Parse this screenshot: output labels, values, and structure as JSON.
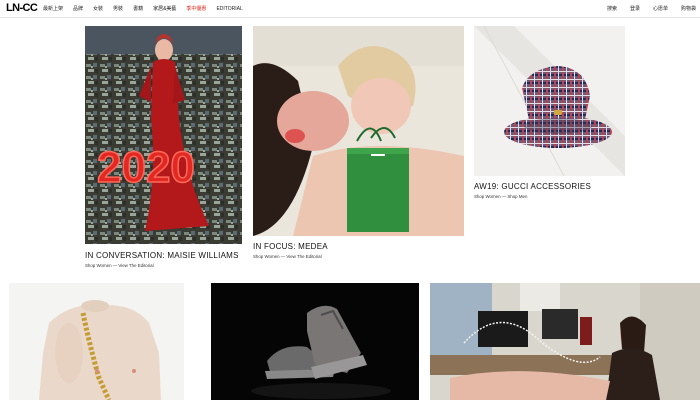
{
  "header": {
    "logo": "LN-CC",
    "nav": [
      "最新上架",
      "品牌",
      "女裝",
      "男裝",
      "書籍",
      "家居&美藝",
      "季中優惠",
      "EDITORIAL"
    ],
    "sale_index": 6,
    "right": [
      "搜索",
      "登录",
      "心愿单",
      "购物袋"
    ]
  },
  "articles": [
    {
      "title": "IN CONVERSATION: MAISIE WILLIAMS",
      "links": [
        "Shop Women",
        "View The Editorial"
      ],
      "separator": " — ",
      "image_overlay": "2020"
    },
    {
      "title": "IN FOCUS: MEDEA",
      "links": [
        "Shop Women",
        "View The Editorial"
      ],
      "separator": " — "
    },
    {
      "title": "AW19: GUCCI ACCESSORIES",
      "links": [
        "Shop Women",
        "Shop Men"
      ],
      "separator": " — "
    }
  ],
  "colors": {
    "sale_red": "#e5281c",
    "text": "#111111"
  }
}
